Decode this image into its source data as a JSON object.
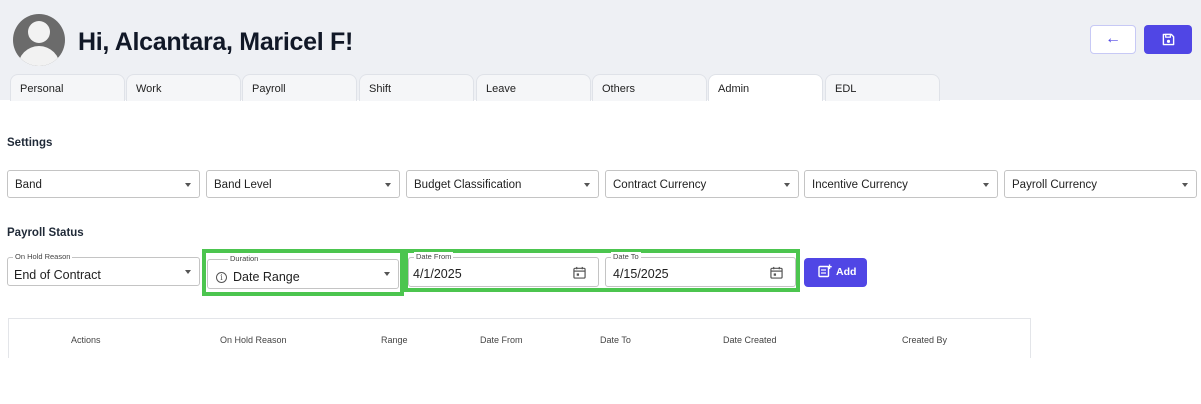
{
  "header": {
    "greeting": "Hi, Alcantara, Maricel F!",
    "back_icon": "←"
  },
  "tabs": [
    {
      "label": "Personal",
      "active": false
    },
    {
      "label": "Work",
      "active": false
    },
    {
      "label": "Payroll",
      "active": false
    },
    {
      "label": "Shift",
      "active": false
    },
    {
      "label": "Leave",
      "active": false
    },
    {
      "label": "Others",
      "active": false
    },
    {
      "label": "Admin",
      "active": true
    },
    {
      "label": "EDL",
      "active": false
    }
  ],
  "settings": {
    "title": "Settings",
    "selects": [
      "Band",
      "Band Level",
      "Budget Classification",
      "Contract Currency",
      "Incentive Currency",
      "Payroll Currency"
    ]
  },
  "payroll_status": {
    "title": "Payroll Status",
    "on_hold_reason": {
      "label": "On Hold Reason",
      "value": "End of Contract"
    },
    "duration": {
      "label": "Duration",
      "value": "Date Range",
      "info_icon": "i"
    },
    "date_from": {
      "label": "Date From",
      "value": "4/1/2025"
    },
    "date_to": {
      "label": "Date To",
      "value": "4/15/2025"
    },
    "add_label": "Add"
  },
  "table": {
    "columns": [
      "Actions",
      "On Hold Reason",
      "Range",
      "Date From",
      "Date To",
      "Date Created",
      "Created By"
    ]
  },
  "colors": {
    "accent": "#5046e5",
    "highlight": "#4cc54f",
    "header_bg": "#eef0f4"
  }
}
